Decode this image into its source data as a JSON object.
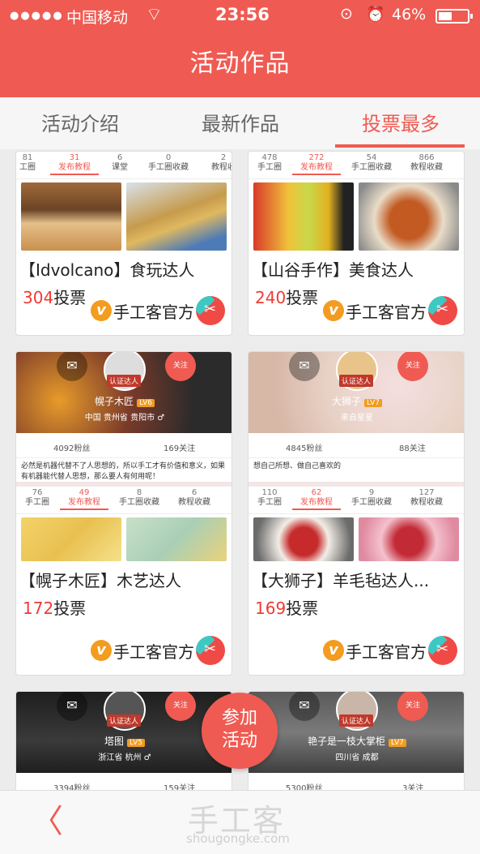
{
  "status_bar": {
    "dots": "●●●●●",
    "carrier": "中国移动",
    "time": "23:56",
    "battery": "46%",
    "battery_level": 0.46
  },
  "header": {
    "title": "活动作品"
  },
  "tabs": [
    {
      "label": "活动介绍",
      "active": false
    },
    {
      "label": "最新作品",
      "active": false
    },
    {
      "label": "投票最多",
      "active": true
    }
  ],
  "cards": [
    {
      "stats": [
        {
          "count": "81",
          "label": "工圈"
        },
        {
          "count": "31",
          "label": "发布教程"
        },
        {
          "count": "6",
          "label": "课堂"
        },
        {
          "count": "0",
          "label": "手工圈收藏"
        },
        {
          "count": "2",
          "label": "教程收"
        }
      ],
      "title": "【Idvolcano】食玩达人",
      "votes": "304",
      "vote_suffix": "投票",
      "author": "手工客官方"
    },
    {
      "stats": [
        {
          "count": "478",
          "label": "手工圈"
        },
        {
          "count": "272",
          "label": "发布教程"
        },
        {
          "count": "54",
          "label": "手工圈收藏"
        },
        {
          "count": "866",
          "label": "教程收藏"
        }
      ],
      "title": "【山谷手作】美食达人",
      "votes": "240",
      "vote_suffix": "投票",
      "author": "手工客官方"
    },
    {
      "profile": {
        "name": "幌子木匠",
        "level": "LV6",
        "badge": "认证达人",
        "follow": "关注",
        "location": "中国 贵州省 贵阳市 ♂",
        "fans": "4092粉丝",
        "following": "169关注",
        "bio": "必然是机器代替不了人思想的，所以手工才有价值和意义，如果有机器能代替人思想，那么要人有何用呢！"
      },
      "stats": [
        {
          "count": "76",
          "label": "手工圈"
        },
        {
          "count": "49",
          "label": "发布教程"
        },
        {
          "count": "8",
          "label": "手工圈收藏"
        },
        {
          "count": "6",
          "label": "教程收藏"
        }
      ],
      "title": "【幌子木匠】木艺达人",
      "votes": "172",
      "vote_suffix": "投票",
      "author": "手工客官方"
    },
    {
      "profile": {
        "name": "大狮子",
        "level": "LV7",
        "badge": "认证达人",
        "follow": "关注",
        "location": "来自星星",
        "fans": "4845粉丝",
        "following": "88关注",
        "bio": "想自己所想、做自己喜欢的"
      },
      "stats": [
        {
          "count": "110",
          "label": "手工圈"
        },
        {
          "count": "62",
          "label": "发布教程"
        },
        {
          "count": "9",
          "label": "手工圈收藏"
        },
        {
          "count": "127",
          "label": "教程收藏"
        }
      ],
      "title": "【大狮子】羊毛毡达人...",
      "votes": "169",
      "vote_suffix": "投票",
      "author": "手工客官方"
    },
    {
      "profile": {
        "name": "塔图",
        "level": "LV5",
        "badge": "认证达人",
        "follow": "关注",
        "location": "浙江省 杭州 ♂",
        "fans": "3394粉丝",
        "following": "159关注"
      }
    },
    {
      "profile": {
        "name": "艳子是一枝大掌柜",
        "level": "LV7",
        "badge": "认证达人",
        "follow": "关注",
        "location": "四川省 成都",
        "fans": "5300粉丝",
        "following": "3关注"
      }
    }
  ],
  "fab": {
    "line1": "参加",
    "line2": "活动"
  },
  "bottom_bar": {
    "back": "〈",
    "watermark": "手工客",
    "watermark_url": "shougongke.com"
  },
  "colors": {
    "brand": "#ef5b52",
    "vote": "#ef3b33"
  }
}
